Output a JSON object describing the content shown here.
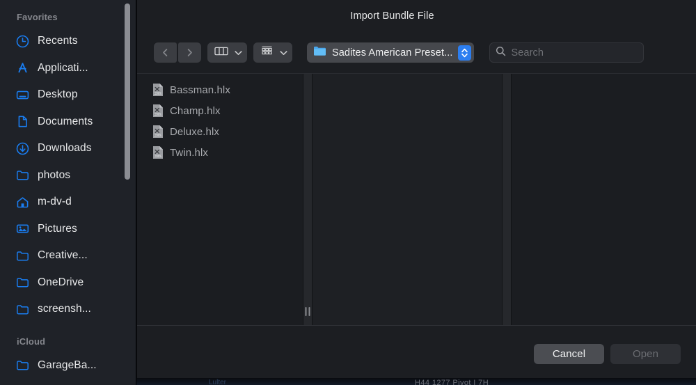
{
  "window": {
    "title": "Import Bundle File"
  },
  "sidebar": {
    "sections": [
      {
        "label": "Favorites",
        "items": [
          {
            "label": "Recents",
            "icon": "clock-icon"
          },
          {
            "label": "Applicati...",
            "icon": "applications-icon"
          },
          {
            "label": "Desktop",
            "icon": "desktop-icon"
          },
          {
            "label": "Documents",
            "icon": "document-icon"
          },
          {
            "label": "Downloads",
            "icon": "download-icon"
          },
          {
            "label": "photos",
            "icon": "folder-icon"
          },
          {
            "label": "m-dv-d",
            "icon": "home-icon"
          },
          {
            "label": "Pictures",
            "icon": "pictures-icon"
          },
          {
            "label": "Creative...",
            "icon": "folder-icon"
          },
          {
            "label": "OneDrive",
            "icon": "folder-icon"
          },
          {
            "label": "screensh...",
            "icon": "folder-icon"
          }
        ]
      },
      {
        "label": "iCloud",
        "items": [
          {
            "label": "GarageBa...",
            "icon": "folder-icon"
          }
        ]
      }
    ]
  },
  "toolbar": {
    "back_icon": "chevron-left-icon",
    "forward_icon": "chevron-right-icon",
    "view_mode_icon": "column-view-icon",
    "view_mode_chevron": "chevron-down-icon",
    "group_by_icon": "arrange-by-icon",
    "group_by_chevron": "chevron-down-icon",
    "path": {
      "label": "Sadites American Preset...",
      "icon": "folder-icon",
      "stepper_icon": "up-down-stepper-icon"
    },
    "search": {
      "placeholder": "Search",
      "value": "",
      "icon": "search-icon"
    }
  },
  "browser": {
    "columns": [
      {
        "files": [
          {
            "name": "Bassman.hlx",
            "icon": "preset-file-icon"
          },
          {
            "name": "Champ.hlx",
            "icon": "preset-file-icon"
          },
          {
            "name": "Deluxe.hlx",
            "icon": "preset-file-icon"
          },
          {
            "name": "Twin.hlx",
            "icon": "preset-file-icon"
          }
        ]
      },
      {
        "files": []
      },
      {
        "files": []
      }
    ],
    "resize_grip_icon": "column-resize-grip-icon"
  },
  "footer": {
    "cancel_label": "Cancel",
    "open_label": "Open",
    "open_enabled": false
  },
  "background": {
    "strip_text": "H44    1277 Pivot I 7H",
    "strip_text2": "Lulter"
  },
  "colors": {
    "accent_blue": "#2c7ef0",
    "sidebar_bg": "#1f2228",
    "dialog_bg": "#1c1e22",
    "column_bg": "#1b1d21",
    "file_text": "#a7a9ad",
    "label_text": "#e8e9ea"
  }
}
